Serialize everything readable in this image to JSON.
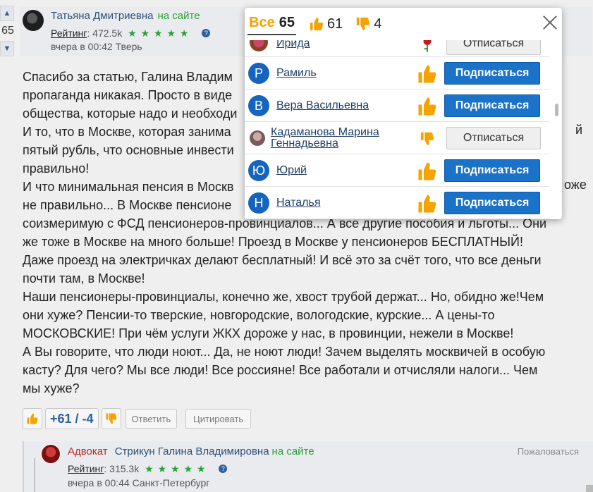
{
  "vote": {
    "up": "▲",
    "count": "65",
    "down": "▼"
  },
  "comment": {
    "author": "Татьяна Дмитриевна",
    "online": "на сайте",
    "rating_label": "Рейтинг",
    "rating_value": ": 472.5k",
    "stars": "★ ★ ★ ★ ★",
    "help": "?",
    "time": "вчера в 00:42",
    "city": "Тверь",
    "paragraphs": [
      "Спасибо за статью, Галина Владим",
      "пропаганда никакая. Просто в виде",
      "общества, которые надо и необходи",
      "И то, что в Москве, которая занима",
      "пятый рубль, что основные инвести",
      "правильно!",
      "И что минимальная пенсия в Москв",
      "не правильно... В Москве пенсионе",
      "соизмеримую с ФСД пенсионеров-провинциалов... А все другие пособия и льготы... Они",
      "же тоже в Москве на много больше! Проезд в Москве у пенсионеров БЕСПЛАТНЫЙ!",
      "Даже проезд на электричках делают бесплатный! И всё это за счёт того, что все деньги",
      "почти там, в Москве!",
      "Наши пенсионеры-провинциалы, конечно же, хвост трубой держат... Но, обидно же!Чем",
      "они хуже? Пенсии-то тверские, новгородские, вологодские, курские... А цены-то",
      "МОСКОВСКИЕ! При чём услуги ЖКХ дороже у нас, в провинции, нежели в Москве!",
      "А Вы говорите, что люди ноют... Да, не ноют люди! Зачем выделять москвичей в особую",
      "касту? Для чего? Мы все люди! Все россияне! Все работали и отчисляли налоги... Чем",
      "мы хуже?"
    ],
    "side_fragments": {
      "r1": "й",
      "r2": "оже"
    }
  },
  "actions": {
    "score": "+61 / -4",
    "reply": "Ответить",
    "quote": "Цитировать"
  },
  "reply": {
    "role": "Адвокат",
    "author": "Стрикун Галина Владимировна",
    "online": "на сайте",
    "complain": "Пожаловаться",
    "rating_label": "Рейтинг",
    "rating_value": ": 315.3k",
    "stars": "★ ★ ★ ★ ★",
    "help": "?",
    "time": "вчера в 00:44",
    "city": "Санкт-Петербург"
  },
  "modal": {
    "tabs": [
      {
        "label": "Все",
        "count": "65"
      },
      {
        "icon": "thumb-up-icon",
        "count": "61"
      },
      {
        "icon": "thumb-down-icon",
        "count": "4"
      }
    ],
    "rows": [
      {
        "name": "Ирида",
        "avatar": "",
        "reaction": "rose-icon",
        "action": "Отписаться",
        "subscribed": true
      },
      {
        "name": "Рамиль",
        "avatar": "Р",
        "reaction": "thumb-up-icon",
        "action": "Подписаться",
        "subscribed": false
      },
      {
        "name": "Вера Васильевна",
        "avatar": "В",
        "reaction": "thumb-up-icon",
        "action": "Подписаться",
        "subscribed": false
      },
      {
        "name": "Кадаманова Марина Геннадьевна",
        "avatar": "",
        "reaction": "thumb-down-icon",
        "action": "Отписаться",
        "subscribed": true
      },
      {
        "name": "Юрий",
        "avatar": "Ю",
        "reaction": "thumb-up-icon",
        "action": "Подписаться",
        "subscribed": false
      },
      {
        "name": "Наталья",
        "avatar": "Н",
        "reaction": "thumb-up-icon",
        "action": "Подписаться",
        "subscribed": false
      }
    ]
  },
  "colors": {
    "accent": "#f5a300",
    "primary_button": "#1a73c8",
    "online": "#2aa137",
    "link": "#2f4f78"
  }
}
